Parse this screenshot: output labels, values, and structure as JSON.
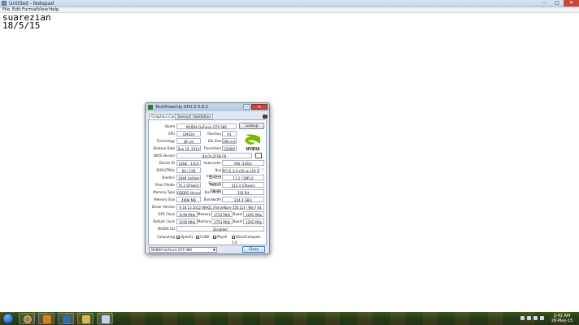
{
  "notepad": {
    "title": "Untitled - Notepad",
    "menu": [
      "File",
      "Edit",
      "Format",
      "View",
      "Help"
    ],
    "lines": [
      "suarezian",
      "18/5/15"
    ],
    "buttons": {
      "minimize": "–",
      "maximize": "□",
      "close": "✕"
    }
  },
  "gpuz": {
    "title": "TechPowerUp GPU-Z 0.8.2",
    "tabs": [
      "Graphics Card",
      "Sensors",
      "Validation"
    ],
    "lookup_label": "Lookup",
    "labels": {
      "name": "Name",
      "gpu": "GPU",
      "revision": "Revision",
      "technology": "Technology",
      "die_size": "Die Size",
      "release_date": "Release Date",
      "transistors": "Transistors",
      "bios_version": "BIOS Version",
      "device_id": "Device ID",
      "subvendor": "Subvendor",
      "rops_tmus": "ROPs/TMUs",
      "bus_interface": "Bus Interface",
      "shaders": "Shaders",
      "directx_support": "DirectX Support",
      "pixel_fillrate": "Pixel Fillrate",
      "texture_fillrate": "Texture Fillrate",
      "memory_type": "Memory Type",
      "bus_width": "Bus Width",
      "memory_size": "Memory Size",
      "bandwidth": "Bandwidth",
      "driver_version": "Driver Version",
      "gpu_clock": "GPU Clock",
      "memory": "Memory",
      "boost": "Boost",
      "default_clock": "Default Clock",
      "nvidia_sli": "NVIDIA SLI",
      "computing": "Computing"
    },
    "values": {
      "name": "NVIDIA GeForce GTX 980",
      "gpu": "GM204",
      "revision": "A1",
      "technology": "28 nm",
      "die_size": "398 mm²",
      "release_date": "Sep 19, 2014",
      "transistors": "5200M",
      "bios_version": "84.04.2F.00.F8",
      "device_id": "10DE - 13C0",
      "subvendor": "MSI (1462)",
      "rops_tmus": "64 / 128",
      "bus_interface": "PCI-E 3.0 x16 @ x16 1.1",
      "shaders": "2048 Unified",
      "directx_support": "11.2 / SM5.0",
      "pixel_fillrate": "76.2 GPixel/s",
      "texture_fillrate": "152.3 GTexel/s",
      "memory_type": "GDDR5 (Hynix)",
      "bus_width": "256 Bit",
      "memory_size": "4096 MB",
      "bandwidth": "224.4 GB/s",
      "driver_version": "9.18.13.5012 WHQL (ForceWare 350.12) / Win7 64",
      "gpu_clock": "1190 MHz",
      "gpu_memory": "1753 MHz",
      "gpu_boost": "1291 MHz",
      "default_clock": "1190 MHz",
      "default_memory": "1753 MHz",
      "default_boost": "1291 MHz",
      "nvidia_sli": "Disabled",
      "bus_question": "?"
    },
    "computing": [
      {
        "label": "OpenCL",
        "checked": "✓"
      },
      {
        "label": "CUDA",
        "checked": "✓"
      },
      {
        "label": "PhysX",
        "checked": "✓"
      },
      {
        "label": "DirectCompute 5.0",
        "checked": "✓"
      }
    ],
    "select_value": "NVIDIA GeForce GTX 980",
    "close_label": "Close",
    "logo_text": "NVIDIA"
  },
  "taskbar": {
    "time": "2:42 AM",
    "date": "28-May-15"
  }
}
